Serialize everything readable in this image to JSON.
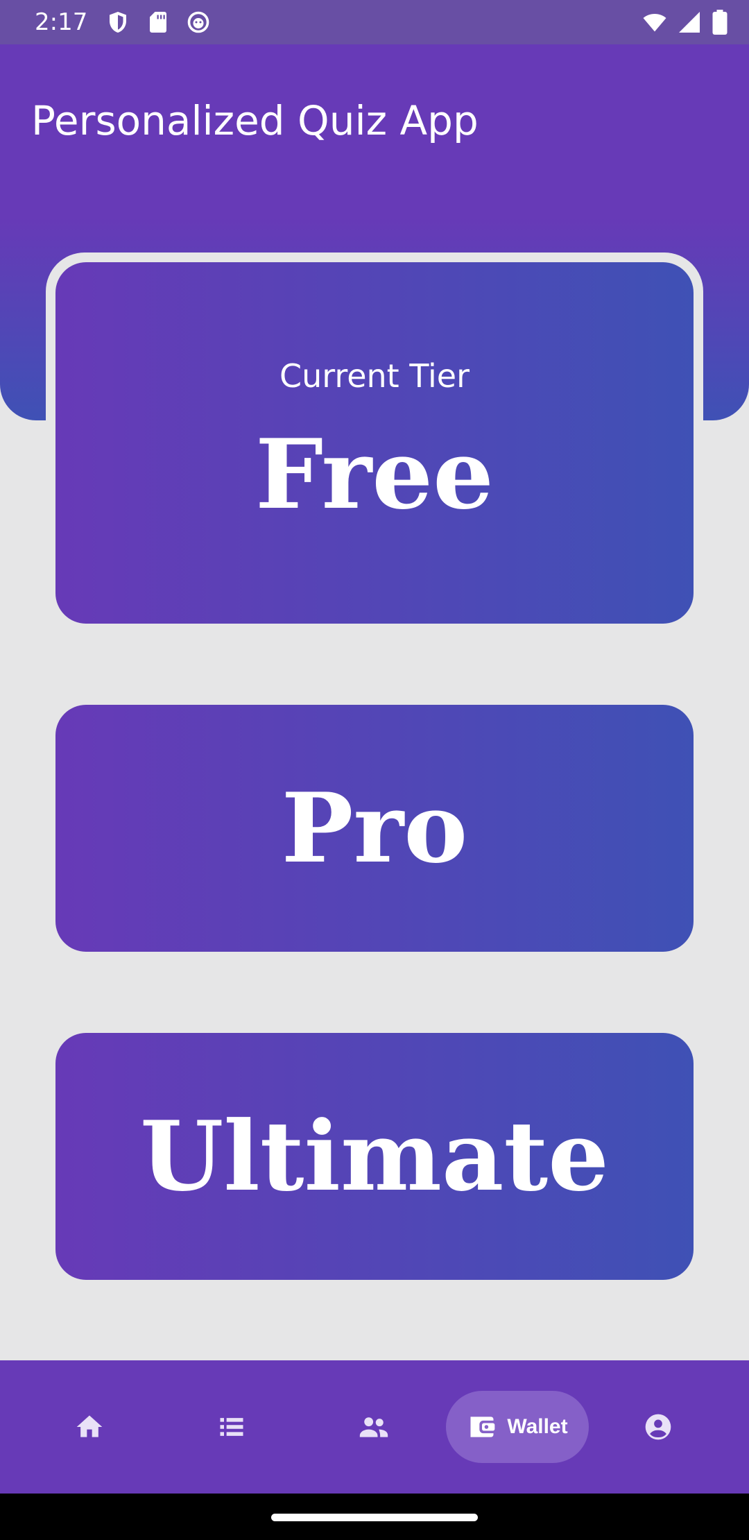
{
  "status": {
    "time": "2:17"
  },
  "app": {
    "title": "Personalized Quiz App"
  },
  "tiers": {
    "current_label": "Current Tier",
    "current": "Free",
    "options": [
      "Pro",
      "Ultimate"
    ]
  },
  "nav": {
    "items": [
      {
        "icon": "home-icon"
      },
      {
        "icon": "list-icon"
      },
      {
        "icon": "people-icon"
      },
      {
        "icon": "wallet-icon",
        "label": "Wallet",
        "selected": true
      },
      {
        "icon": "account-icon"
      }
    ]
  },
  "colors": {
    "primary": "#673ab7",
    "secondary": "#3f51b5",
    "background": "#e6e6e7",
    "nav_pill": "#8560c8"
  }
}
